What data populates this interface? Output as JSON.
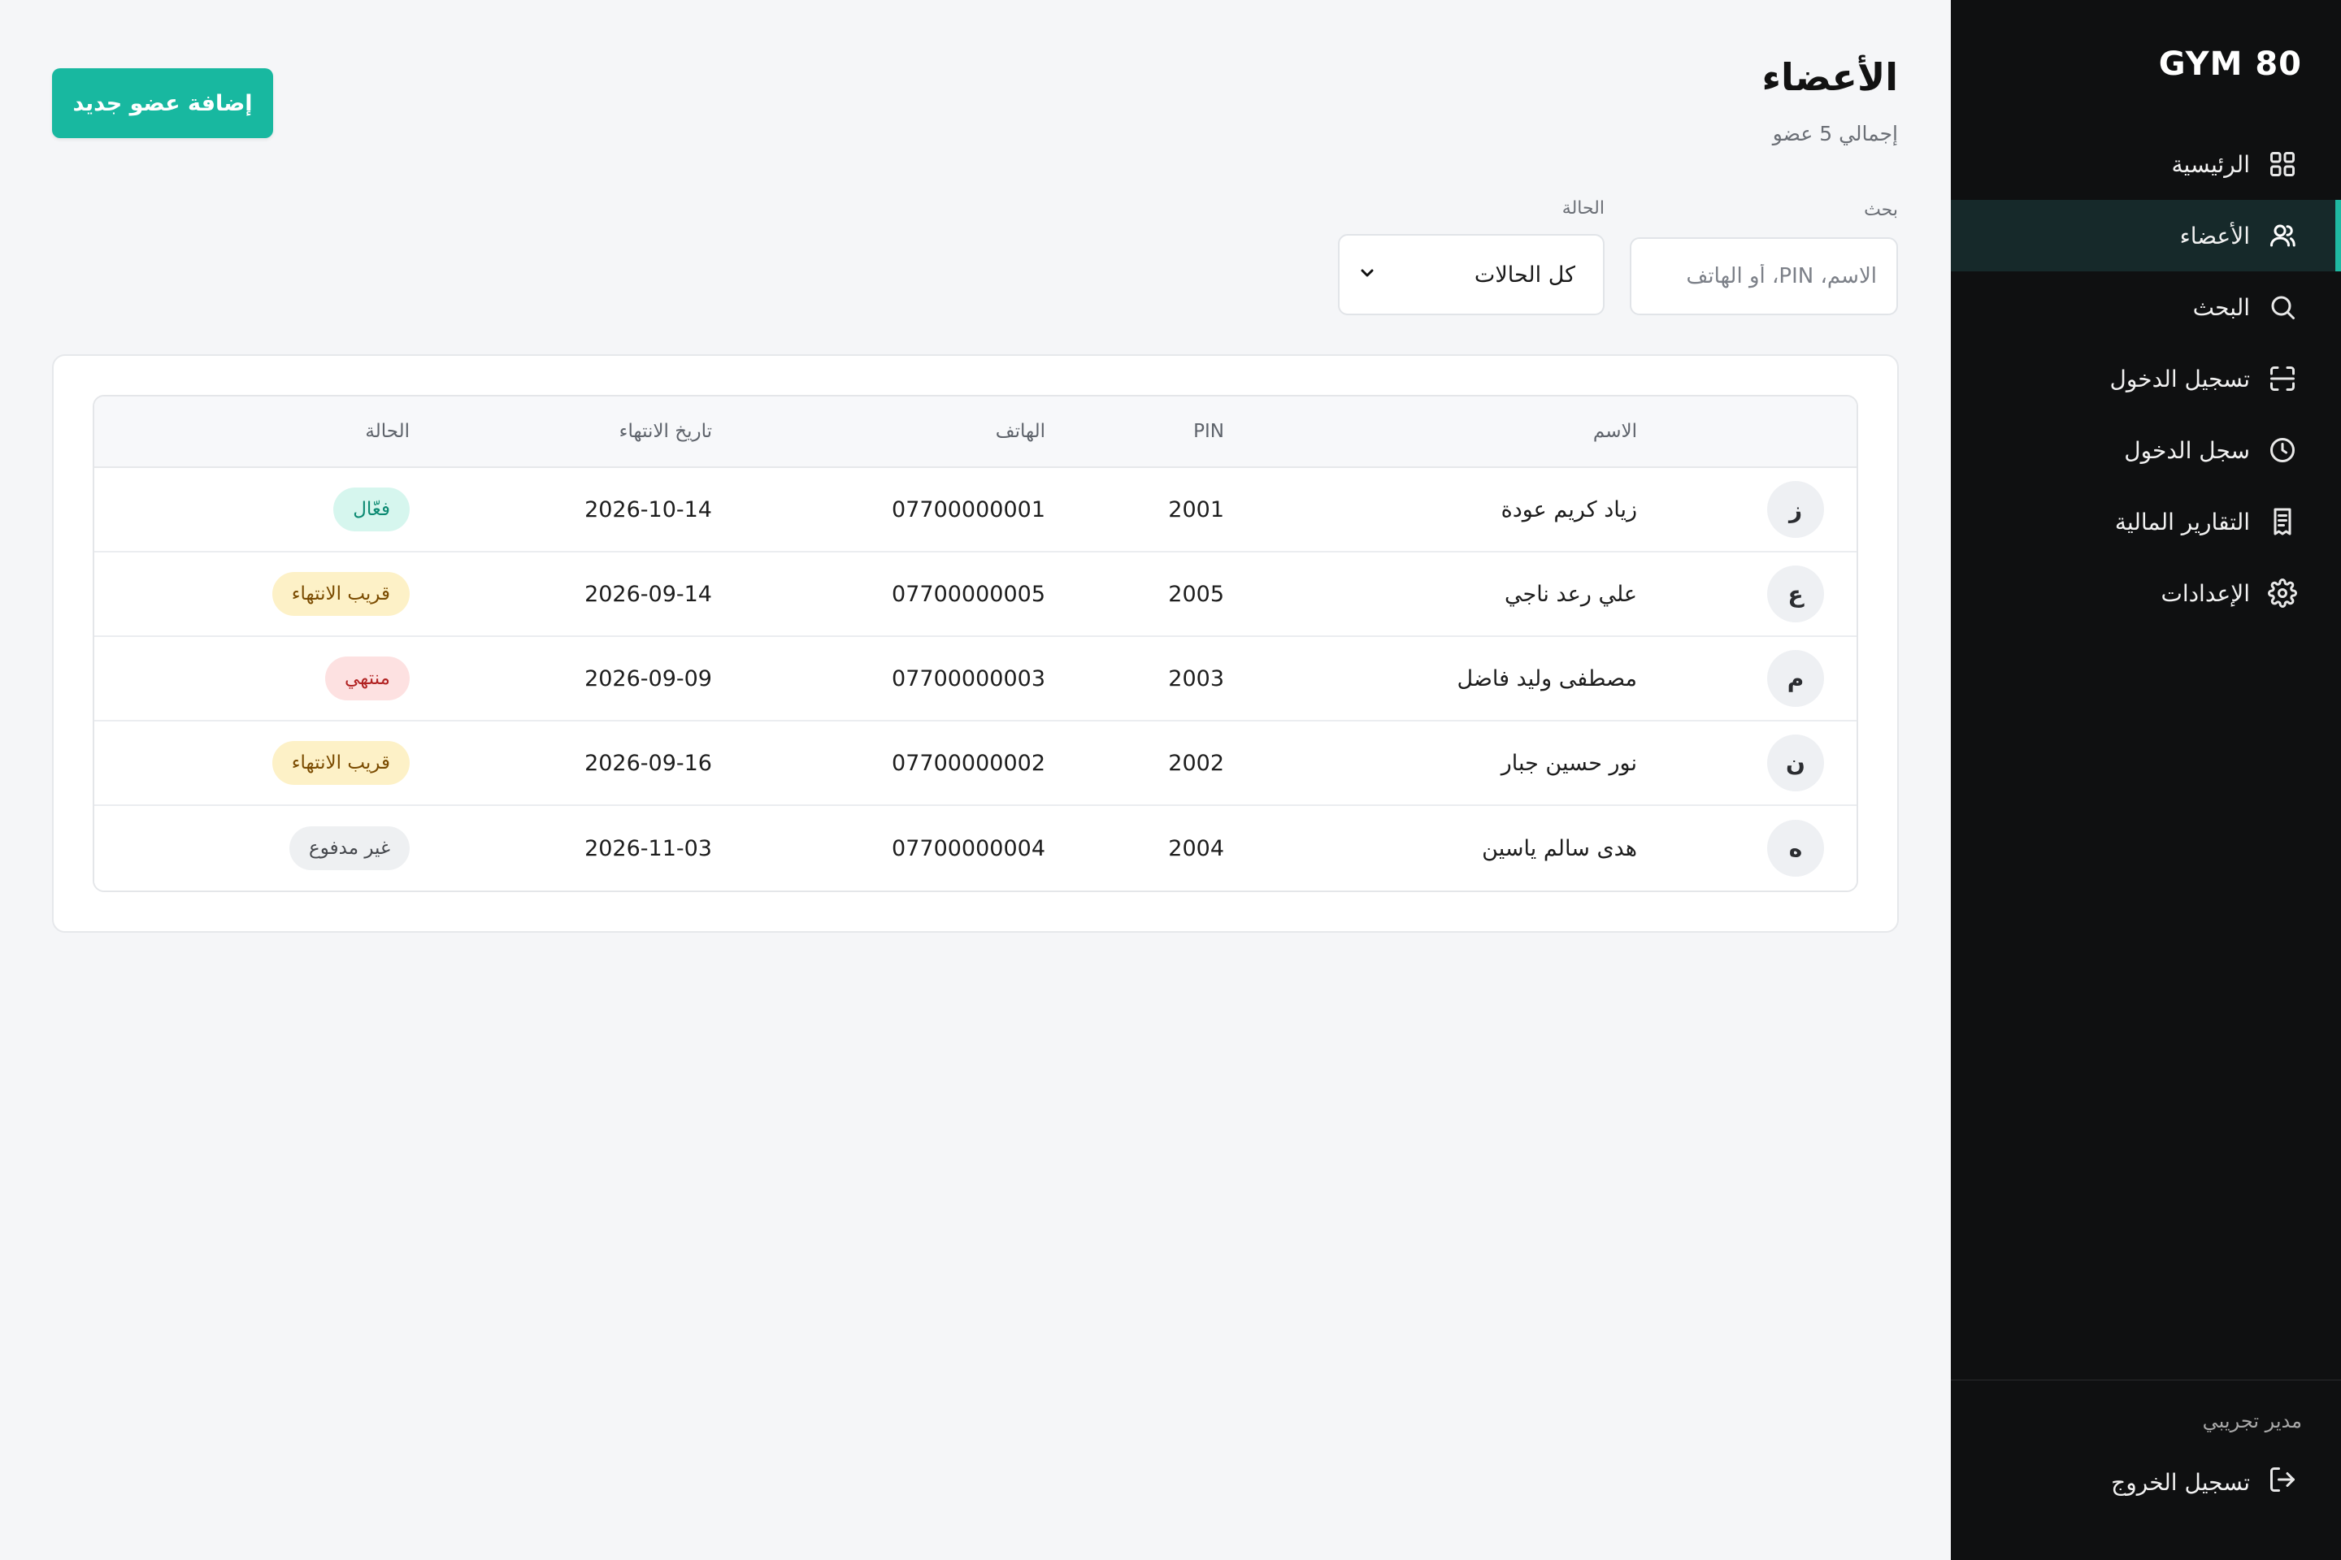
{
  "app": {
    "brand": "GYM 80"
  },
  "sidebar": {
    "items": [
      {
        "label": "الرئيسية",
        "icon": "grid-icon"
      },
      {
        "label": "الأعضاء",
        "icon": "users-icon",
        "active": true
      },
      {
        "label": "البحث",
        "icon": "search-icon"
      },
      {
        "label": "تسجيل الدخول",
        "icon": "scan-icon"
      },
      {
        "label": "سجل الدخول",
        "icon": "clock-icon"
      },
      {
        "label": "التقارير المالية",
        "icon": "receipt-icon"
      },
      {
        "label": "الإعدادات",
        "icon": "gear-icon"
      }
    ],
    "user_name": "مدير تجريبي",
    "logout_label": "تسجيل الخروج"
  },
  "header": {
    "title": "الأعضاء",
    "subtitle": "إجمالي 5 عضو",
    "add_button": "إضافة عضو جديد"
  },
  "filters": {
    "search_label": "بحث",
    "search_placeholder": "الاسم، PIN، أو الهاتف",
    "status_label": "الحالة",
    "status_value": "كل الحالات"
  },
  "table": {
    "columns": {
      "name": "الاسم",
      "pin": "PIN",
      "phone": "الهاتف",
      "expiry": "تاريخ الانتهاء",
      "status": "الحالة"
    },
    "rows": [
      {
        "initial": "ز",
        "name": "زياد كريم عودة",
        "pin": "2001",
        "phone": "07700000001",
        "expiry": "2026-10-14",
        "status": "فعّال",
        "status_type": "active"
      },
      {
        "initial": "ع",
        "name": "علي رعد ناجي",
        "pin": "2005",
        "phone": "07700000005",
        "expiry": "2026-09-14",
        "status": "قريب الانتهاء",
        "status_type": "soon"
      },
      {
        "initial": "م",
        "name": "مصطفى وليد فاضل",
        "pin": "2003",
        "phone": "07700000003",
        "expiry": "2026-09-09",
        "status": "منتهي",
        "status_type": "expired"
      },
      {
        "initial": "ن",
        "name": "نور حسين جبار",
        "pin": "2002",
        "phone": "07700000002",
        "expiry": "2026-09-16",
        "status": "قريب الانتهاء",
        "status_type": "soon"
      },
      {
        "initial": "ه",
        "name": "هدى سالم ياسين",
        "pin": "2004",
        "phone": "07700000004",
        "expiry": "2026-11-03",
        "status": "غير مدفوع",
        "status_type": "unpaid"
      }
    ]
  },
  "colors": {
    "accent": "#18b8a0",
    "sidebar_bg": "#0f1011",
    "active_badge": "#d6f6ee",
    "soon_badge": "#fdf1c7",
    "expired_badge": "#fde1e1",
    "unpaid_badge": "#eef0f2"
  }
}
